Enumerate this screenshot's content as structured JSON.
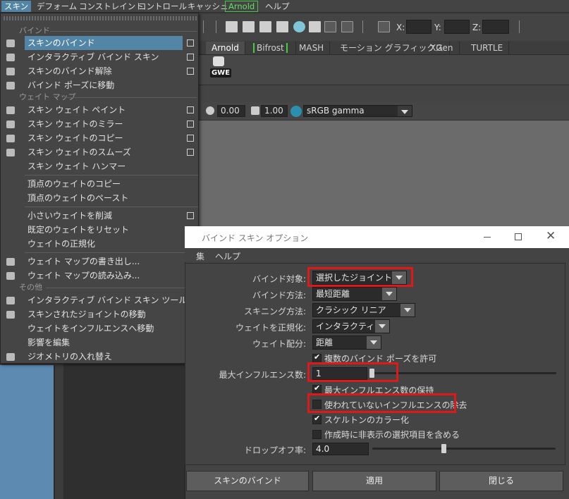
{
  "menubar": {
    "items": [
      "スキン",
      "デフォーム",
      "コンストレイント",
      "コントロール",
      "キャッシュ",
      "Arnold",
      "ヘルプ"
    ]
  },
  "toolbar": {
    "x_label": "X:",
    "y_label": "Y:",
    "z_label": "Z:"
  },
  "shelf": {
    "tabs": [
      "Arnold",
      "Bifrost",
      "MASH",
      "モーション グラフィックス",
      "XGen",
      "TURTLE"
    ],
    "gwe_label": "GWE"
  },
  "viewport_bar": {
    "exposure": "0.00",
    "gamma": "1.00",
    "colorspace": "sRGB gamma"
  },
  "skin_menu": {
    "section_bind": "バインド",
    "section_weightmap": "ウェイト マップ",
    "section_other": "その他",
    "items": [
      "スキンのバインド",
      "インタラクティブ バインド スキン",
      "スキンのバインド解除",
      "バインド ポーズに移動",
      "スキン ウェイト ペイント",
      "スキン ウェイトのミラー",
      "スキン ウェイトのコピー",
      "スキン ウェイトのスムーズ",
      "スキン ウェイト ハンマー",
      "頂点のウェイトのコピー",
      "頂点のウェイトのペースト",
      "小さいウェイトを削減",
      "既定のウェイトをリセット",
      "ウェイトの正規化",
      "ウェイト マップの書き出し...",
      "ウェイト マップの読み込み...",
      "インタラクティブ バインド スキン ツール",
      "スキンされたジョイントの移動",
      "ウェイトをインフルエンスへ移動",
      "影響を編集",
      "ジオメトリの入れ替え"
    ]
  },
  "dialog": {
    "title": "バインド スキン オプション",
    "menu_edit": "集",
    "menu_help": "ヘルプ",
    "bind_target_label": "バインド対象:",
    "bind_target_value": "選択したジョイント",
    "bind_method_label": "バインド方法:",
    "bind_method_value": "最短距離",
    "skinning_method_label": "スキニング方法:",
    "skinning_method_value": "クラシック リニア",
    "normalize_label": "ウェイトを正規化:",
    "normalize_value": "インタラクティブ",
    "weight_dist_label": "ウェイト配分:",
    "weight_dist_value": "距離",
    "allow_multiple_bind_poses": "複数のバインド ポーズを許可",
    "max_influences_label": "最大インフルエンス数:",
    "max_influences_value": "1",
    "maintain_max_influences": "最大インフルエンス数の保持",
    "remove_unused_influences": "使われていないインフルエンスの除去",
    "colorize_skeleton": "スケルトンのカラー化",
    "include_hidden": "作成時に非表示の選択項目を含める",
    "dropoff_label": "ドロップオフ率:",
    "dropoff_value": "4.0",
    "btn_bind": "スキンのバインド",
    "btn_apply": "適用",
    "btn_close": "閉じる"
  }
}
